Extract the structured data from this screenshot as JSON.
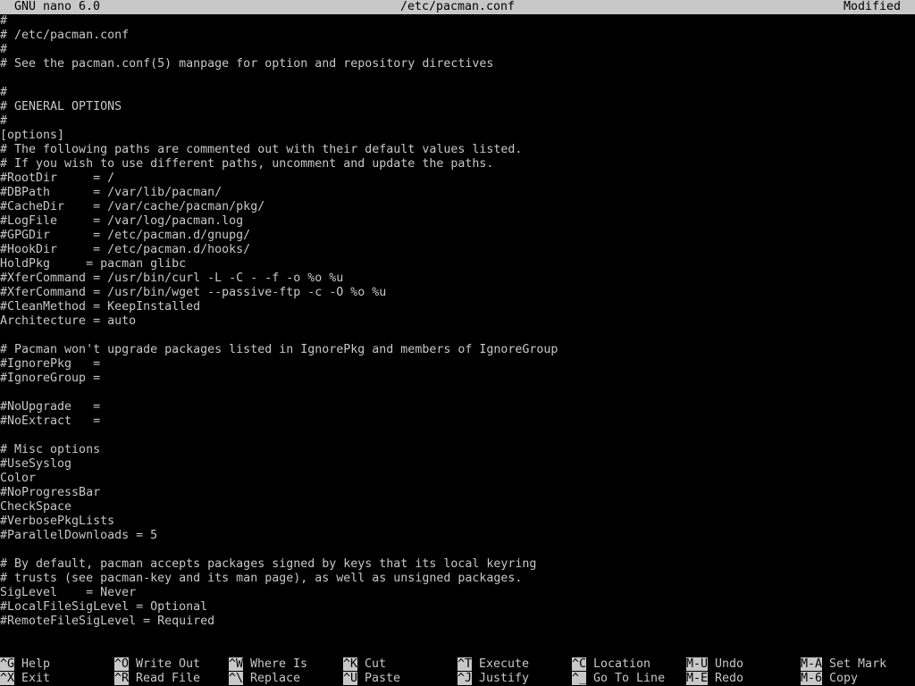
{
  "title_bar": {
    "app": "GNU nano 6.0",
    "file": "/etc/pacman.conf",
    "status": "Modified"
  },
  "editor": {
    "lines": [
      "#",
      "# /etc/pacman.conf",
      "#",
      "# See the pacman.conf(5) manpage for option and repository directives",
      "",
      "#",
      "# GENERAL OPTIONS",
      "#",
      "[options]",
      "# The following paths are commented out with their default values listed.",
      "# If you wish to use different paths, uncomment and update the paths.",
      "#RootDir     = /",
      "#DBPath      = /var/lib/pacman/",
      "#CacheDir    = /var/cache/pacman/pkg/",
      "#LogFile     = /var/log/pacman.log",
      "#GPGDir      = /etc/pacman.d/gnupg/",
      "#HookDir     = /etc/pacman.d/hooks/",
      "HoldPkg     = pacman glibc",
      "#XferCommand = /usr/bin/curl -L -C - -f -o %o %u",
      "#XferCommand = /usr/bin/wget --passive-ftp -c -O %o %u",
      "#CleanMethod = KeepInstalled",
      "Architecture = auto",
      "",
      "# Pacman won't upgrade packages listed in IgnorePkg and members of IgnoreGroup",
      "#IgnorePkg   =",
      "#IgnoreGroup =",
      "",
      "#NoUpgrade   =",
      "#NoExtract   =",
      "",
      "# Misc options",
      "#UseSyslog",
      "Color",
      "#NoProgressBar",
      "CheckSpace",
      "#VerbosePkgLists",
      "#ParallelDownloads = 5",
      "",
      "# By default, pacman accepts packages signed by keys that its local keyring",
      "# trusts (see pacman-key and its man page), as well as unsigned packages.",
      "SigLevel    = Never",
      "#LocalFileSigLevel = Optional",
      "#RemoteFileSigLevel = Required"
    ]
  },
  "shortcuts": {
    "row1": [
      {
        "key": "^G",
        "label": "Help"
      },
      {
        "key": "^O",
        "label": "Write Out"
      },
      {
        "key": "^W",
        "label": "Where Is"
      },
      {
        "key": "^K",
        "label": "Cut"
      },
      {
        "key": "^T",
        "label": "Execute"
      },
      {
        "key": "^C",
        "label": "Location"
      },
      {
        "key": "M-U",
        "label": "Undo"
      },
      {
        "key": "M-A",
        "label": "Set Mark"
      }
    ],
    "row2": [
      {
        "key": "^X",
        "label": "Exit"
      },
      {
        "key": "^R",
        "label": "Read File"
      },
      {
        "key": "^\\",
        "label": "Replace"
      },
      {
        "key": "^U",
        "label": "Paste"
      },
      {
        "key": "^J",
        "label": "Justify"
      },
      {
        "key": "^_",
        "label": "Go To Line"
      },
      {
        "key": "M-E",
        "label": "Redo"
      },
      {
        "key": "M-6",
        "label": "Copy"
      }
    ]
  },
  "colors": {
    "background": "#000000",
    "foreground": "#c8c8c8",
    "inverse_bg": "#c8c8c8",
    "inverse_fg": "#000000"
  }
}
